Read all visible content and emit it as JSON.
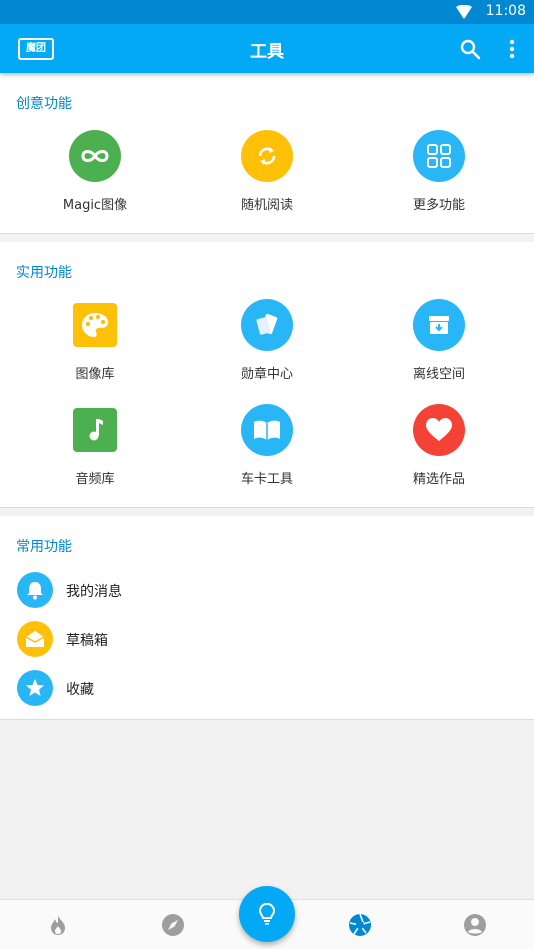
{
  "status": {
    "time": "11:08"
  },
  "appbar": {
    "logo_text": "魔团",
    "title": "工具"
  },
  "creative": {
    "title": "创意功能",
    "items": [
      {
        "label": "Magic图像",
        "icon": "infinity-icon",
        "color": "#4caf50"
      },
      {
        "label": "随机阅读",
        "icon": "shuffle-refresh-icon",
        "color": "#ffc107"
      },
      {
        "label": "更多功能",
        "icon": "grid-icon",
        "color": "#29b6f6"
      }
    ]
  },
  "practical": {
    "title": "实用功能",
    "items": [
      {
        "label": "图像库",
        "icon": "palette-icon",
        "color": "#ffc107"
      },
      {
        "label": "勋章中心",
        "icon": "cards-icon",
        "color": "#29b6f6"
      },
      {
        "label": "离线空间",
        "icon": "archive-icon",
        "color": "#29b6f6"
      },
      {
        "label": "音频库",
        "icon": "music-note-icon",
        "color": "#4caf50"
      },
      {
        "label": "车卡工具",
        "icon": "book-icon",
        "color": "#29b6f6"
      },
      {
        "label": "精选作品",
        "icon": "heart-icon",
        "color": "#f44336"
      }
    ]
  },
  "common": {
    "title": "常用功能",
    "items": [
      {
        "label": "我的消息",
        "icon": "bell-icon",
        "color": "#29b6f6"
      },
      {
        "label": "草稿箱",
        "icon": "envelope-open-icon",
        "color": "#ffc107"
      },
      {
        "label": "收藏",
        "icon": "star-icon",
        "color": "#29b6f6"
      }
    ]
  },
  "bottom_nav": [
    "fire-icon",
    "compass-icon",
    "lightbulb-icon",
    "aperture-icon",
    "account-icon"
  ],
  "colors": {
    "primary": "#03a9f4",
    "primary_dark": "#0288d1",
    "accent_text": "#0288d1"
  }
}
